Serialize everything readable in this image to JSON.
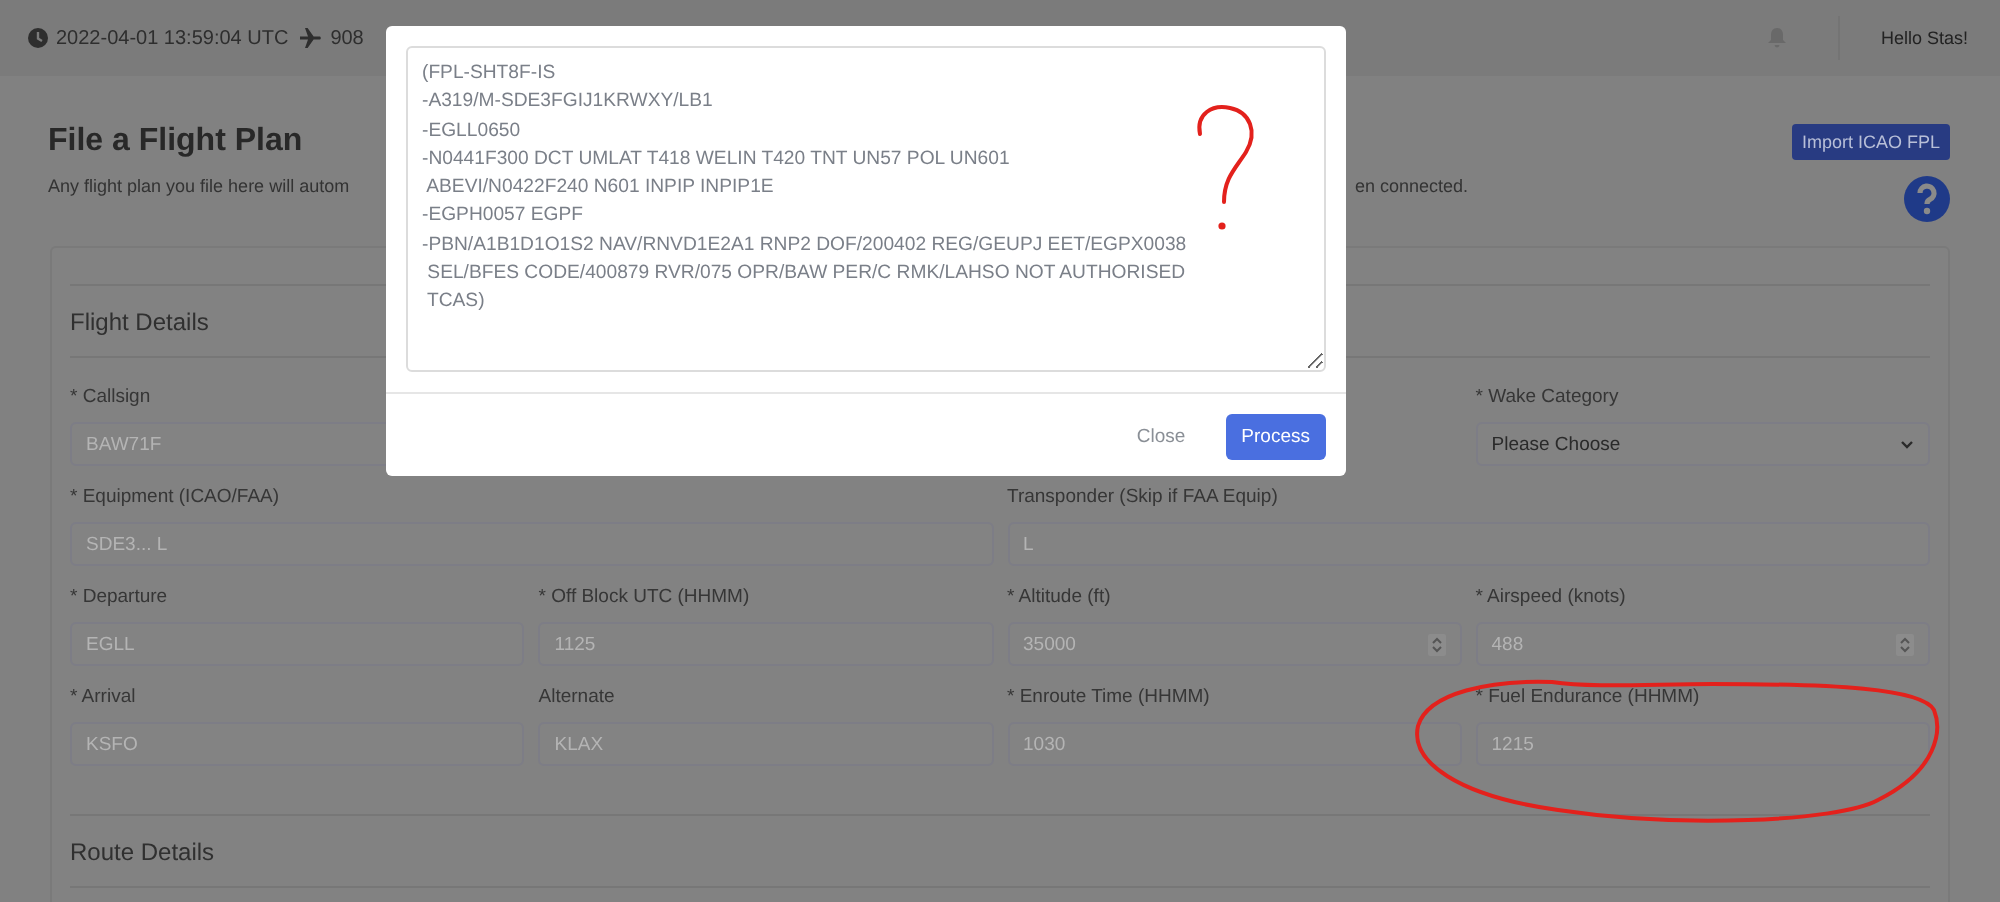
{
  "top_bar": {
    "time": "2022-04-01 13:59:04 UTC",
    "flights": "908",
    "greeting": "Hello Stas!"
  },
  "page": {
    "title": "File a Flight Plan",
    "subtitle_start": "Any flight plan you file here will autom",
    "subtitle_end": "en connected.",
    "import_button": "Import ICAO FPL"
  },
  "sections": [
    {
      "title": "Flight Details"
    },
    {
      "title": "Route Details"
    }
  ],
  "fields": [
    {
      "kind": "text",
      "label": "* Callsign",
      "placeholder": "BAW71F"
    },
    {
      "kind": "select",
      "label": "* Wake Category",
      "value": "Please Choose"
    },
    {
      "kind": "text",
      "label": "* Equipment (ICAO/FAA)",
      "placeholder": "SDE3... L"
    },
    {
      "kind": "text",
      "label": "Transponder (Skip if FAA Equip)",
      "placeholder": "L"
    },
    {
      "kind": "text",
      "label": "* Departure",
      "placeholder": "EGLL"
    },
    {
      "kind": "text",
      "label": "* Off Block UTC (HHMM)",
      "placeholder": "1125"
    },
    {
      "kind": "number",
      "label": "* Altitude (ft)",
      "placeholder": "35000"
    },
    {
      "kind": "number",
      "label": "* Airspeed (knots)",
      "placeholder": "488"
    },
    {
      "kind": "text",
      "label": "* Arrival",
      "placeholder": "KSFO"
    },
    {
      "kind": "text",
      "label": "Alternate",
      "placeholder": "KLAX"
    },
    {
      "kind": "text",
      "label": "* Enroute Time (HHMM)",
      "placeholder": "1030"
    },
    {
      "kind": "text",
      "label": "* Fuel Endurance (HHMM)",
      "placeholder": "1215"
    }
  ],
  "modal": {
    "lines": [
      "(FPL-SHT8F-IS",
      "-A319/M-SDE3FGIJ1KRWXY/LB1",
      "-EGLL0650",
      "-N0441F300 DCT UMLAT T418 WELIN T420 TNT UN57 POL UN601",
      " ABEVI/N0422F240 N601 INPIP INPIP1E",
      "-EGPH0057 EGPF",
      "-PBN/A1B1D1O1S2 NAV/RNVD1E2A1 RNP2 DOF/200402 REG/GEUPJ EET/EGPX0038",
      " SEL/BFES CODE/400879 RVR/075 OPR/BAW PER/C RMK/LAHSO NOT AUTHORISED",
      " TCAS)"
    ],
    "buttons": [
      {
        "kind": "secondary",
        "label": "Close"
      },
      {
        "kind": "primary",
        "label": "Process"
      }
    ]
  }
}
